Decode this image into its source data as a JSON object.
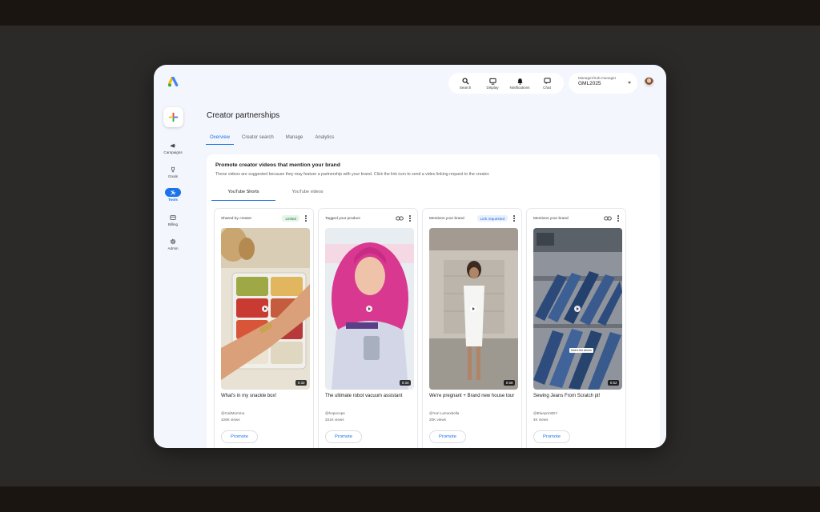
{
  "app": {
    "logo": "google-ads-logo",
    "colors": {
      "accent": "#1a73e8",
      "window_bg": "#f4f6fd",
      "backdrop": "#2b2a29"
    }
  },
  "topbar": {
    "items": [
      {
        "label": "Search",
        "icon": "search-icon"
      },
      {
        "label": "Display",
        "icon": "display-icon"
      },
      {
        "label": "Notifications",
        "icon": "bell-icon"
      },
      {
        "label": "Chat",
        "icon": "chat-icon"
      }
    ],
    "account": {
      "role": "Manager/Sub-manager",
      "name": "GML2025"
    }
  },
  "sidebar": {
    "create_icon": "plus-icon",
    "items": [
      {
        "label": "Campaigns",
        "icon": "megaphone-icon",
        "active": false
      },
      {
        "label": "Goals",
        "icon": "trophy-icon",
        "active": false
      },
      {
        "label": "Tools",
        "icon": "tools-icon",
        "active": true
      },
      {
        "label": "Billing",
        "icon": "credit-card-icon",
        "active": false
      },
      {
        "label": "Admin",
        "icon": "gear-icon",
        "active": false
      }
    ]
  },
  "page": {
    "title": "Creator partnerships",
    "tabs": [
      "Overview",
      "Creator search",
      "Manage",
      "Analytics"
    ],
    "active_tab": "Overview"
  },
  "section": {
    "title": "Promote creator videos that mention your brand",
    "description": "These videos are suggested because they may feature a partnership with your brand. Click the link icon to send a video linking request to the creator.",
    "subtabs": [
      "YouTube Shorts",
      "YouTube videos"
    ],
    "active_subtab": "YouTube Shorts"
  },
  "videos": [
    {
      "status": "Shared by creator",
      "badge": "Linked",
      "badge_type": "linked",
      "duration": "0:32",
      "title": "What's in my snackle box!",
      "handle": "@CaliMomma",
      "views": "426K views",
      "button": "Promote"
    },
    {
      "status": "Tagged your product",
      "badge": "",
      "badge_type": "link",
      "duration": "0:34",
      "title": "The ultimate robot vacuum assistant",
      "handle": "@hopecope",
      "views": "331K views",
      "button": "Promote"
    },
    {
      "status": "Mentions your brand",
      "badge": "Link requested",
      "badge_type": "requested",
      "duration": "0:58",
      "title": "We're pregnant + Brand new house tour",
      "handle": "@Yuri Lamexbella",
      "views": "20K views",
      "button": "Promote"
    },
    {
      "status": "Mentions your brand",
      "badge": "",
      "badge_type": "link",
      "duration": "0:52",
      "title": "Sewing Jeans From Scratch pt!",
      "handle": "@BlueprintDIY",
      "views": "4K views",
      "button": "Promote",
      "caption": "here's the denim"
    }
  ]
}
